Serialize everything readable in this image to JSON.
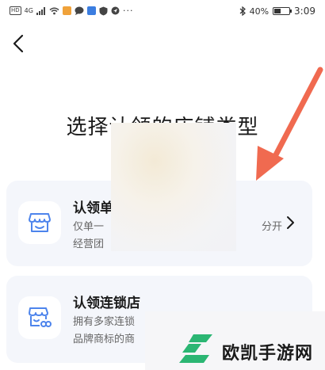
{
  "status_bar": {
    "left_badges": [
      "HD",
      "4G"
    ],
    "battery": "40%",
    "battery_fraction": 0.4,
    "time": "3:09",
    "icons": [
      "hd-icon",
      "signal-icon",
      "wifi-icon",
      "app-icon",
      "chat-icon",
      "app-icon",
      "shield-icon",
      "location-icon",
      "more-icon",
      "bluetooth-icon",
      "battery-icon"
    ]
  },
  "header": {
    "back_icon": "chevron-left-icon"
  },
  "page": {
    "title": "选择认领的店铺类型"
  },
  "cards": [
    {
      "title": "认领单",
      "desc_line1": "仅单一",
      "desc_line1_tail": "分开",
      "desc_line2": "经营团",
      "icon": "storefront-icon",
      "arrow_icon": "chevron-right-icon"
    },
    {
      "title": "认领连锁店",
      "desc_line1": "拥有多家连锁",
      "desc_line2": "品牌商标的商",
      "icon": "chain-store-icon"
    }
  ],
  "watermark": {
    "text": "欧凯手游网",
    "logo": "logo-icon"
  },
  "colors": {
    "accent": "#5b8ef0",
    "card_bg": "#f4f6fb",
    "annotation_arrow": "#f06a50",
    "watermark_green": "#2bb673"
  }
}
